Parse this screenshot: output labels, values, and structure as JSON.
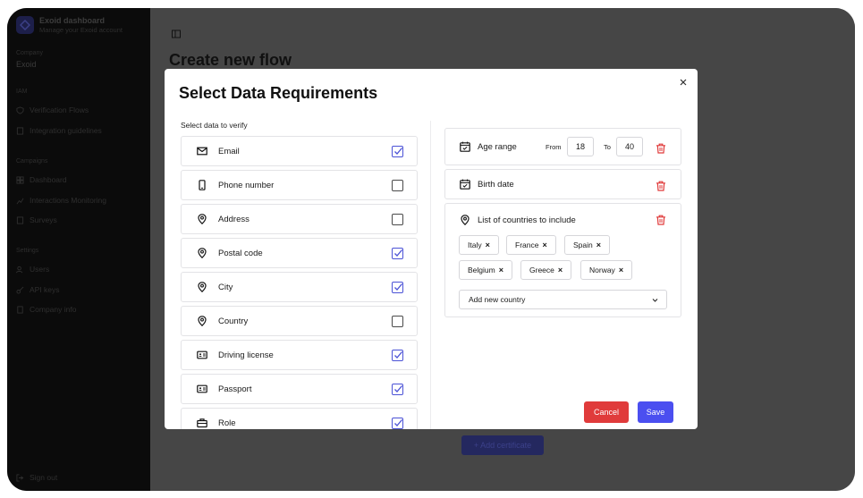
{
  "sidebar": {
    "brand_title": "Exoid dashboard",
    "brand_subtitle": "Manage your Exoid account",
    "company_label": "Company",
    "company_name": "Exoid",
    "sections": [
      {
        "label": "IAM",
        "items": [
          "Verification Flows",
          "Integration guidelines"
        ]
      },
      {
        "label": "Campaigns",
        "items": [
          "Dashboard",
          "Interactions Monitoring",
          "Surveys"
        ]
      },
      {
        "label": "Settings",
        "items": [
          "Users",
          "API keys",
          "Company info"
        ]
      }
    ],
    "sign_out": "Sign out"
  },
  "main": {
    "title": "Create new flow",
    "add_certificate": "+ Add certificate"
  },
  "modal": {
    "title": "Select Data Requirements",
    "left_label": "Select data to verify",
    "items": [
      {
        "label": "Email",
        "icon": "mail-icon",
        "checked": true
      },
      {
        "label": "Phone number",
        "icon": "phone-icon",
        "checked": false
      },
      {
        "label": "Address",
        "icon": "location-pin-icon",
        "checked": false
      },
      {
        "label": "Postal code",
        "icon": "location-pin-icon",
        "checked": true
      },
      {
        "label": "City",
        "icon": "location-pin-icon",
        "checked": true
      },
      {
        "label": "Country",
        "icon": "location-pin-icon",
        "checked": false
      },
      {
        "label": "Driving license",
        "icon": "id-card-icon",
        "checked": true
      },
      {
        "label": "Passport",
        "icon": "id-card-icon",
        "checked": true
      },
      {
        "label": "Role",
        "icon": "briefcase-icon",
        "checked": true
      }
    ],
    "age_range": {
      "label": "Age range",
      "from_label": "From",
      "from_value": "18",
      "to_label": "To",
      "to_value": "40"
    },
    "birth_date": {
      "label": "Birth date"
    },
    "countries": {
      "label": "List of countries to include",
      "chips": [
        "Italy",
        "France",
        "Spain",
        "Belgium",
        "Greece",
        "Norway"
      ],
      "chip_remove": "×",
      "add_placeholder": "Add new country"
    },
    "cancel_label": "Cancel",
    "save_label": "Save"
  },
  "colors": {
    "accent": "#4b4ff0",
    "danger": "#e03b3b",
    "checkbox_checked": "#4b52d6"
  }
}
